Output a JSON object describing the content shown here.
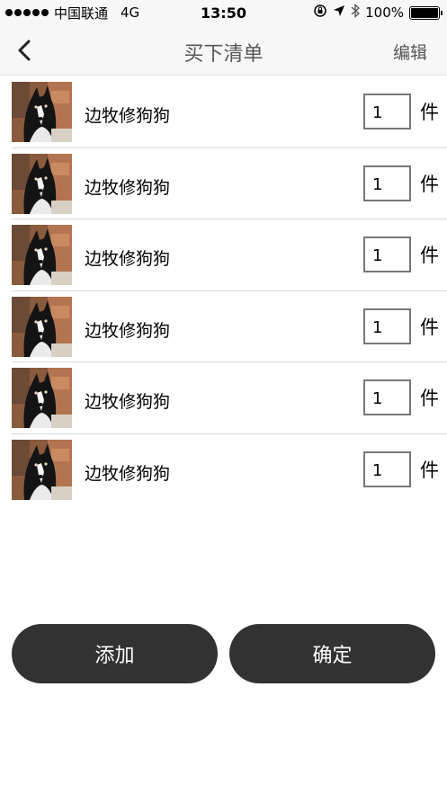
{
  "status_bar": {
    "carrier": "中国联通",
    "network": "4G",
    "time": "13:50",
    "battery": "100%",
    "battery_level": 1.0
  },
  "nav": {
    "title": "买下清单",
    "edit_label": "编辑",
    "back_icon": "chevron-left-icon"
  },
  "items": [
    {
      "name": "边牧修狗狗",
      "quantity": "1",
      "unit": "件"
    },
    {
      "name": "边牧修狗狗",
      "quantity": "1",
      "unit": "件"
    },
    {
      "name": "边牧修狗狗",
      "quantity": "1",
      "unit": "件"
    },
    {
      "name": "边牧修狗狗",
      "quantity": "1",
      "unit": "件"
    },
    {
      "name": "边牧修狗狗",
      "quantity": "1",
      "unit": "件"
    },
    {
      "name": "边牧修狗狗",
      "quantity": "1",
      "unit": "件"
    }
  ],
  "actions": {
    "add_label": "添加",
    "confirm_label": "确定"
  },
  "colors": {
    "button_bg": "#323232",
    "nav_bg": "#f7f7f8",
    "title_text": "#555555"
  }
}
